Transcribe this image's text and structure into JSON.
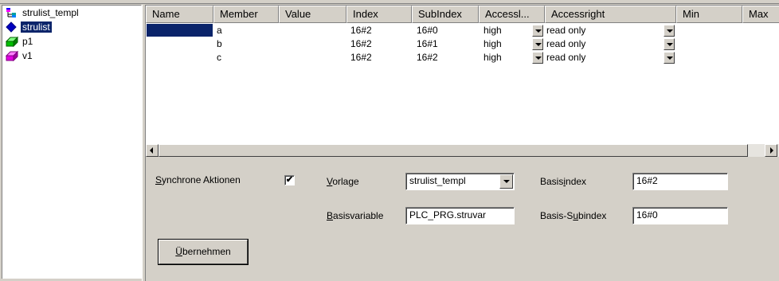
{
  "tree": {
    "items": [
      {
        "label": "strulist_templ",
        "icon": "template-icon"
      },
      {
        "label": "strulist",
        "icon": "diamond-icon",
        "selected": true
      },
      {
        "label": "p1",
        "icon": "green-object-icon"
      },
      {
        "label": "v1",
        "icon": "pink-object-icon"
      }
    ]
  },
  "grid": {
    "headers": [
      "Name",
      "Member",
      "Value",
      "Index",
      "SubIndex",
      "Accessl...",
      "Accessright",
      "Min",
      "Max"
    ],
    "rows": [
      {
        "name": "",
        "member": "a",
        "value": "",
        "index": "16#2",
        "subindex": "16#0",
        "access": "high",
        "accessright": "read only"
      },
      {
        "name": "",
        "member": "b",
        "value": "",
        "index": "16#2",
        "subindex": "16#1",
        "access": "high",
        "accessright": "read only"
      },
      {
        "name": "",
        "member": "c",
        "value": "",
        "index": "16#2",
        "subindex": "16#2",
        "access": "high",
        "accessright": "read only"
      }
    ]
  },
  "props": {
    "sync_label_u": "S",
    "sync_label_rest": "ynchrone Aktionen",
    "sync_checked": "✔",
    "vorlage_u": "V",
    "vorlage_rest": "orlage",
    "vorlage_value": "strulist_templ",
    "basisvariable_u": "B",
    "basisvariable_rest": "asisvariable",
    "basisvariable_value": "PLC_PRG.struvar",
    "basisindex_pre": "Basis",
    "basisindex_u": "i",
    "basisindex_post": "ndex",
    "basisindex_value": "16#2",
    "basissub_pre": "Basis-S",
    "basissub_u": "u",
    "basissub_post": "bindex",
    "basissub_value": "16#0",
    "apply_u": "Ü",
    "apply_rest": "bernehmen"
  }
}
